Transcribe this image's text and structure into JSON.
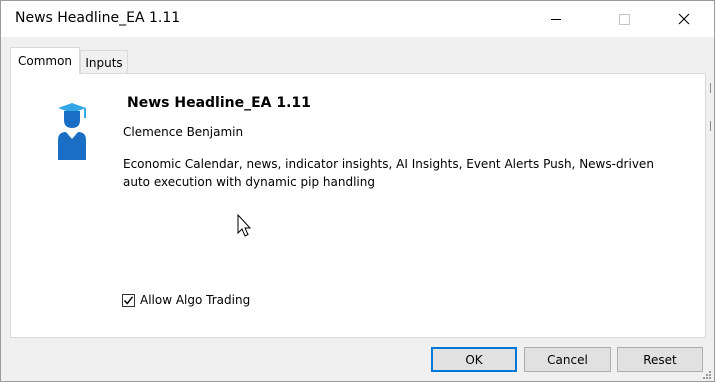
{
  "window": {
    "title": "News Headline_EA 1.11"
  },
  "tabs": [
    {
      "label": "Common",
      "active": true
    },
    {
      "label": "Inputs",
      "active": false
    }
  ],
  "expert": {
    "name": "News Headline_EA 1.11",
    "author": "Clemence Benjamin",
    "description": "Economic Calendar, news, indicator insights, AI Insights, Event Alerts  Push, News-driven auto execution with dynamic pip handling",
    "icon": "graduate-icon"
  },
  "options": {
    "allow_algo_trading": {
      "label": "Allow Algo Trading",
      "checked": true
    }
  },
  "buttons": {
    "ok": "OK",
    "cancel": "Cancel",
    "reset": "Reset"
  },
  "colors": {
    "accent": "#0078d7",
    "icon_blue": "#1a6fc4",
    "icon_light": "#34a7e8"
  }
}
